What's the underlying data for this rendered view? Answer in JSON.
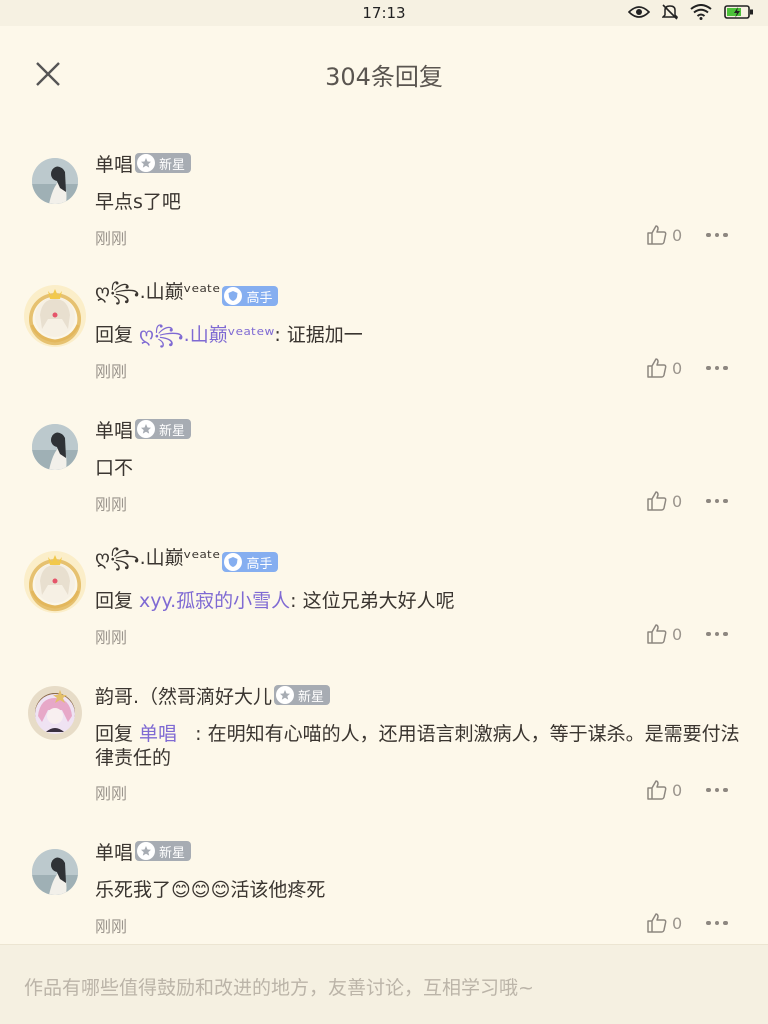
{
  "status_bar": {
    "time": "17:13"
  },
  "header": {
    "title": "304条回复"
  },
  "comments": [
    {
      "username": "单唱",
      "badge": "新星",
      "text": "早点s了吧",
      "time": "刚刚",
      "likes": "0"
    },
    {
      "username": "ღ꧂.山巅ᵛᵉᵃᵗᵉ",
      "badge": "高手",
      "reply_prefix": "回复 ",
      "reply_to": "ღ꧂.山巅ᵛᵉᵃᵗᵉʷ",
      "text": ": 证据加一",
      "time": "刚刚",
      "likes": "0"
    },
    {
      "username": "单唱",
      "badge": "新星",
      "text": "口不",
      "time": "刚刚",
      "likes": "0"
    },
    {
      "username": "ღ꧂.山巅ᵛᵉᵃᵗᵉ",
      "badge": "高手",
      "reply_prefix": "回复 ",
      "reply_to": "xyy.孤寂的小雪人",
      "text": ": 这位兄弟大好人呢",
      "time": "刚刚",
      "likes": "0"
    },
    {
      "username": "韵哥.（然哥滴好大儿",
      "badge": "新星",
      "reply_prefix": "回复 ",
      "reply_to": "单唱",
      "text": "   : 在明知有心喵的人，还用语言刺激病人，等于谋杀。是需要付法律责任的",
      "time": "刚刚",
      "likes": "0"
    },
    {
      "username": "单唱",
      "badge": "新星",
      "text": "乐死我了😊😊😊活该他疼死",
      "time": "刚刚",
      "likes": "0"
    }
  ],
  "input": {
    "placeholder": "作品有哪些值得鼓励和改进的地方，友善讨论，互相学习哦~"
  },
  "colors": {
    "background": "#fdf8ea",
    "reply_user": "#7f6ad3",
    "badge_newstar": "#a7acb3",
    "badge_expert": "#85aef0"
  }
}
